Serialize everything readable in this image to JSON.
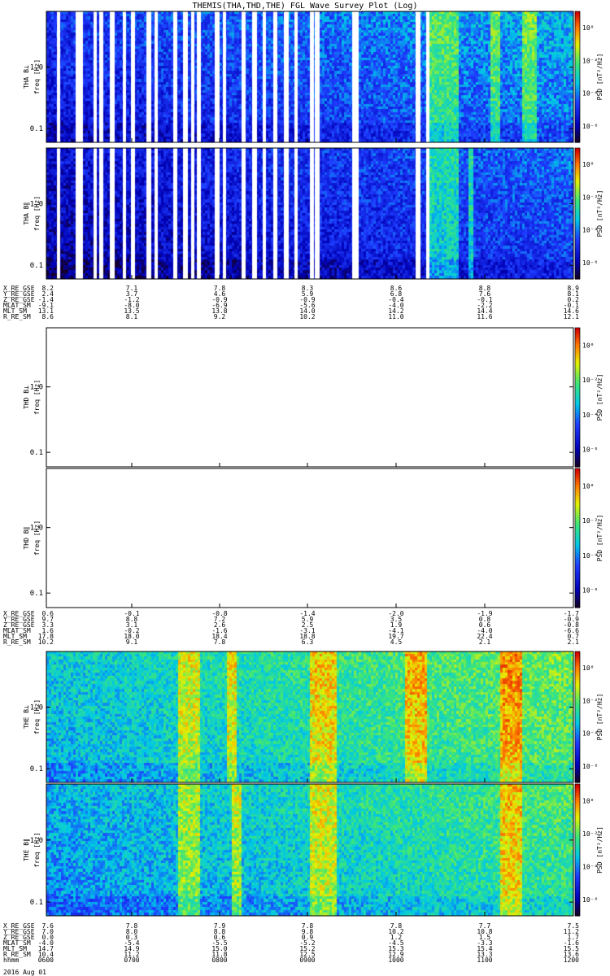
{
  "title": "THEMIS(THA,THD,THE) FGL Wave Survey Plot (Log)",
  "colorbar": {
    "label": "PSD [nT²/Hz]",
    "ticks": [
      "10⁰",
      "10⁻²",
      "10⁻⁴",
      "10⁻⁶"
    ],
    "tick_exponents": [
      0,
      -2,
      -4,
      -6
    ]
  },
  "chart_data": {
    "type": "heatmap",
    "y_scale": "log",
    "y_range_hz": [
      0.06,
      8
    ],
    "y_ticks": [
      "1.0",
      "0.1"
    ],
    "y_tick_values": [
      1.0,
      0.1
    ],
    "x_range_hhmm": [
      "0600",
      "1200"
    ],
    "panels": [
      {
        "probe": "THA",
        "component": "B⊥",
        "ylabel_1": "THA B⊥",
        "ylabel_2": "freq [Hz]",
        "has_data": true,
        "seed": 11,
        "gaps": [
          0.02,
          0.055,
          0.06,
          0.09,
          0.1,
          0.12,
          0.145,
          0.16,
          0.19,
          0.205,
          0.24,
          0.26,
          0.275,
          0.285,
          0.32,
          0.335,
          0.37,
          0.39,
          0.41,
          0.43,
          0.45,
          0.47,
          0.5,
          0.51,
          0.58,
          0.585,
          0.7,
          0.72
        ],
        "bursts": [
          [
            0.72,
            0.78
          ],
          [
            0.84,
            0.86
          ],
          [
            0.9,
            0.93
          ]
        ],
        "base": -5.6,
        "slope": 1.8
      },
      {
        "probe": "THA",
        "component": "B∥",
        "ylabel_1": "THA B∥",
        "ylabel_2": "freq [Hz]",
        "has_data": true,
        "seed": 23,
        "gaps": [
          0.02,
          0.055,
          0.06,
          0.09,
          0.1,
          0.12,
          0.145,
          0.16,
          0.19,
          0.205,
          0.24,
          0.26,
          0.275,
          0.285,
          0.32,
          0.335,
          0.37,
          0.39,
          0.41,
          0.43,
          0.45,
          0.47,
          0.5,
          0.51,
          0.58,
          0.585,
          0.7,
          0.72
        ],
        "bursts": [
          [
            0.72,
            0.78
          ],
          [
            0.8,
            0.81
          ]
        ],
        "base": -6.2,
        "slope": 1.6
      },
      {
        "probe": "THD",
        "component": "B⊥",
        "ylabel_1": "THD B⊥",
        "ylabel_2": "freq [Hz]",
        "has_data": false
      },
      {
        "probe": "THD",
        "component": "B∥",
        "ylabel_1": "THD B∥",
        "ylabel_2": "freq [Hz]",
        "has_data": false
      },
      {
        "probe": "THE",
        "component": "B⊥",
        "ylabel_1": "THE B⊥",
        "ylabel_2": "freq [Hz]",
        "has_data": true,
        "seed": 37,
        "gaps": [],
        "bursts": [
          [
            0.25,
            0.29
          ],
          [
            0.34,
            0.36
          ],
          [
            0.5,
            0.55
          ],
          [
            0.68,
            0.72
          ],
          [
            0.86,
            0.9
          ]
        ],
        "base": -3.6,
        "slope": 1.0
      },
      {
        "probe": "THE",
        "component": "B∥",
        "ylabel_1": "THE B∥",
        "ylabel_2": "freq [Hz]",
        "has_data": true,
        "seed": 53,
        "gaps": [],
        "bursts": [
          [
            0.25,
            0.29
          ],
          [
            0.35,
            0.37
          ],
          [
            0.5,
            0.55
          ],
          [
            0.86,
            0.9
          ]
        ],
        "base": -4.0,
        "slope": 1.1
      }
    ]
  },
  "ephemeris": [
    {
      "rows": [
        {
          "label": "X_RE_GSE",
          "values": [
            "8.2",
            "7.1",
            "7.8",
            "8.3",
            "8.6",
            "8.8",
            "8.9"
          ]
        },
        {
          "label": "Y_RE_GSE",
          "values": [
            "2.4",
            "3.7",
            "4.6",
            "5.9",
            "6.8",
            "7.6",
            "8.1"
          ]
        },
        {
          "label": "Z_RE_GSE",
          "values": [
            "-1.4",
            "-1.2",
            "-0.9",
            "-0.9",
            "-0.4",
            "-0.1",
            "0.2"
          ]
        },
        {
          "label": "MLAT_SM",
          "values": [
            "-9.1",
            "-8.0",
            "-6.9",
            "-5.6",
            "-4.0",
            "-2.2",
            "-0.1"
          ]
        },
        {
          "label": "MLT_SM",
          "values": [
            "13.1",
            "13.5",
            "13.8",
            "14.0",
            "14.2",
            "14.4",
            "14.6"
          ]
        },
        {
          "label": "R_RE_SM",
          "values": [
            "8.6",
            "8.1",
            "9.2",
            "10.2",
            "11.0",
            "11.6",
            "12.1"
          ]
        }
      ]
    },
    {
      "rows": [
        {
          "label": "X_RE_GSE",
          "values": [
            "0.6",
            "-0.1",
            "-0.8",
            "-1.4",
            "-2.0",
            "-1.9",
            "-1.7"
          ]
        },
        {
          "label": "Y_RE_GSE",
          "values": [
            "9.7",
            "8.8",
            "7.2",
            "5.9",
            "3.5",
            "0.8",
            "-0.9"
          ]
        },
        {
          "label": "Z_RE_GSE",
          "values": [
            "3.3",
            "3.1",
            "2.6",
            "2.5",
            "1.9",
            "0.6",
            "-0.8"
          ]
        },
        {
          "label": "MLAT_SM",
          "values": [
            "1.6",
            "-0.2",
            "-1.6",
            "-3.1",
            "-4.1",
            "-4.0",
            "-6.6"
          ]
        },
        {
          "label": "MLT_SM",
          "values": [
            "17.8",
            "18.0",
            "18.4",
            "18.8",
            "19.7",
            "22.4",
            "0.7"
          ]
        },
        {
          "label": "R_RE_SM",
          "values": [
            "10.2",
            "9.1",
            "7.8",
            "6.3",
            "4.5",
            "2.1",
            "2.1"
          ]
        }
      ]
    },
    {
      "rows": [
        {
          "label": "X_RE_GSE",
          "values": [
            "7.6",
            "7.8",
            "7.9",
            "7.8",
            "7.8",
            "7.7",
            "7.5"
          ]
        },
        {
          "label": "Y_RE_GSE",
          "values": [
            "7.0",
            "8.0",
            "8.8",
            "9.8",
            "10.2",
            "10.8",
            "11.2"
          ]
        },
        {
          "label": "Z_RE_GSE",
          "values": [
            "0.0",
            "0.3",
            "0.6",
            "0.9",
            "1.2",
            "1.5",
            "1.7"
          ]
        },
        {
          "label": "MLAT_SM",
          "values": [
            "-4.0",
            "-5.4",
            "-5.5",
            "-5.2",
            "-4.5",
            "-3.3",
            "-1.6"
          ]
        },
        {
          "label": "MLT_SM",
          "values": [
            "14.7",
            "14.9",
            "15.0",
            "15.2",
            "15.3",
            "15.4",
            "15.5"
          ]
        },
        {
          "label": "R_RE_SM",
          "values": [
            "10.4",
            "11.2",
            "11.8",
            "12.5",
            "12.9",
            "13.3",
            "13.6"
          ]
        },
        {
          "label": "hhmm",
          "values": [
            "0600",
            "0700",
            "0800",
            "0900",
            "1000",
            "1100",
            "1200"
          ]
        }
      ]
    }
  ],
  "date_label": "2016 Aug 01"
}
